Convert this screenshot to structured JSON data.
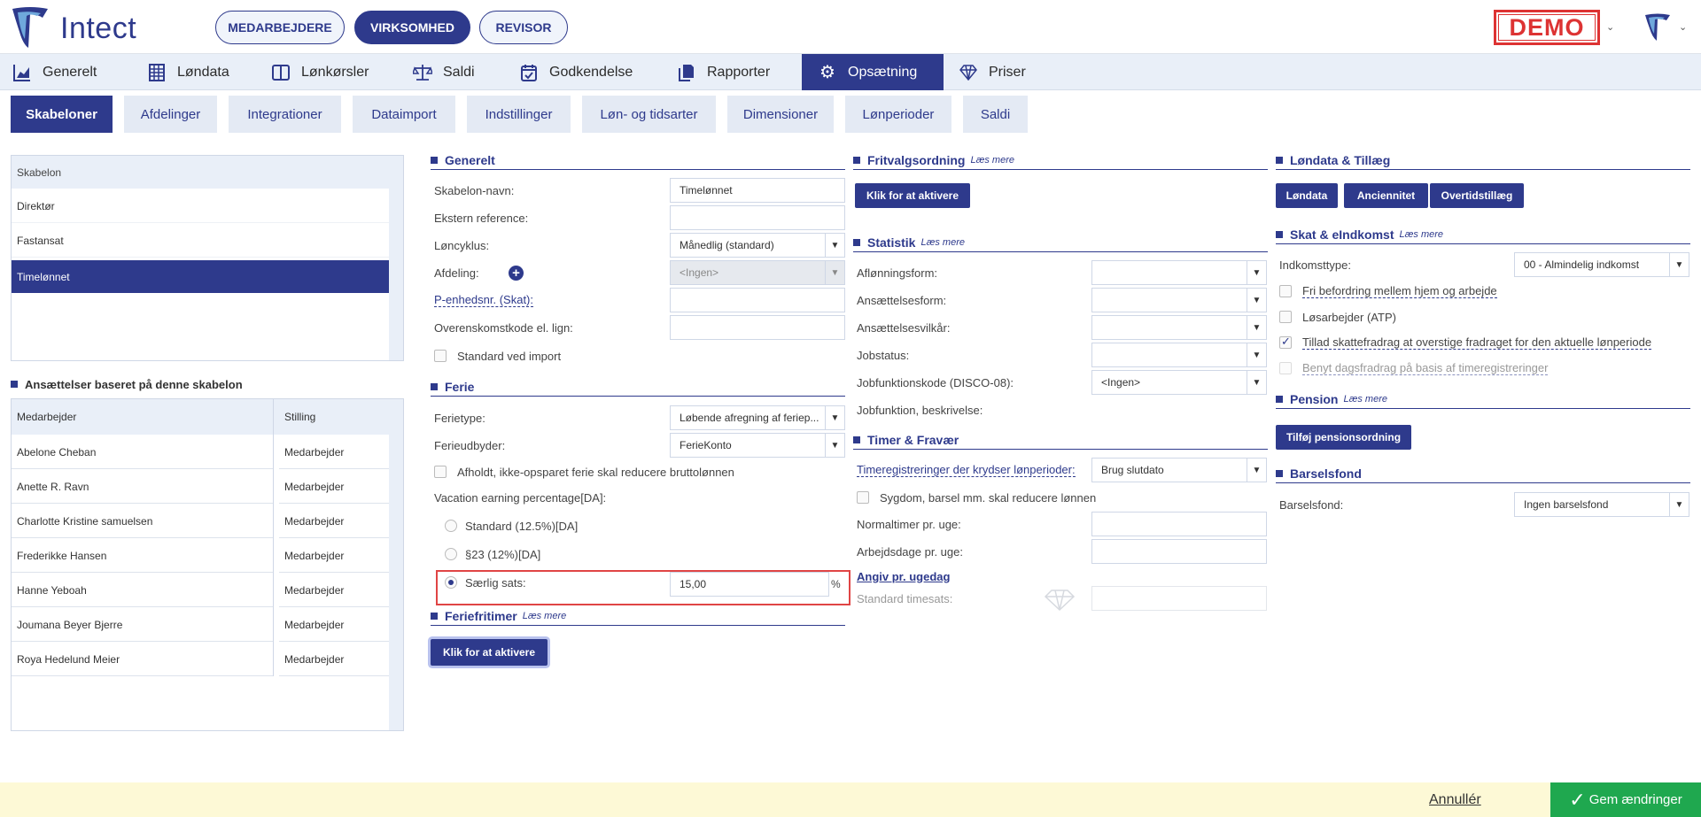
{
  "brand": {
    "name": "Intect",
    "demo_badge": "DEMO",
    "accent": "#2e3a8c",
    "success": "#1fa84f",
    "warning_outline": "#d33"
  },
  "top_pills": [
    {
      "label": "MEDARBEJDERE",
      "active": false
    },
    {
      "label": "VIRKSOMHED",
      "active": true
    },
    {
      "label": "REVISOR",
      "active": false
    }
  ],
  "main_nav": [
    {
      "label": "Generelt",
      "icon": "chart-icon"
    },
    {
      "label": "Løndata",
      "icon": "table-icon"
    },
    {
      "label": "Lønkørsler",
      "icon": "book-icon"
    },
    {
      "label": "Saldi",
      "icon": "scale-icon"
    },
    {
      "label": "Godkendelse",
      "icon": "calendar-check-icon"
    },
    {
      "label": "Rapporter",
      "icon": "documents-icon"
    },
    {
      "label": "Opsætning",
      "icon": "gear-icon",
      "active": true
    },
    {
      "label": "Priser",
      "icon": "diamond-icon"
    }
  ],
  "sub_tabs": [
    {
      "label": "Skabeloner",
      "active": true
    },
    {
      "label": "Afdelinger"
    },
    {
      "label": "Integrationer"
    },
    {
      "label": "Dataimport"
    },
    {
      "label": "Indstillinger"
    },
    {
      "label": "Løn- og tidsarter"
    },
    {
      "label": "Dimensioner"
    },
    {
      "label": "Lønperioder"
    },
    {
      "label": "Saldi"
    }
  ],
  "templates": {
    "header": "Skabelon",
    "items": [
      "Direktør",
      "Fastansat",
      "Timelønnet"
    ],
    "selected": "Timelønnet"
  },
  "employments": {
    "title": "Ansættelser baseret på denne skabelon",
    "columns": [
      "Medarbejder",
      "Stilling"
    ],
    "rows": [
      [
        "Abelone Cheban",
        "Medarbejder"
      ],
      [
        "Anette R. Ravn",
        "Medarbejder"
      ],
      [
        "Charlotte Kristine samuelsen",
        "Medarbejder"
      ],
      [
        "Frederikke Hansen",
        "Medarbejder"
      ],
      [
        "Hanne Yeboah",
        "Medarbejder"
      ],
      [
        "Joumana Beyer Bjerre",
        "Medarbejder"
      ],
      [
        "Roya Hedelund Meier",
        "Medarbejder"
      ]
    ]
  },
  "generelt": {
    "title": "Generelt",
    "name_label": "Skabelon-navn:",
    "name_value": "Timelønnet",
    "extref_label": "Ekstern reference:",
    "cycle_label": "Løncyklus:",
    "cycle_value": "Månedlig (standard)",
    "dept_label": "Afdeling:",
    "dept_value": "<Ingen>",
    "punit_label": "P-enhedsnr. (Skat):",
    "agreement_label": "Overenskomstkode el. lign:",
    "std_import_label": "Standard ved import"
  },
  "ferie": {
    "title": "Ferie",
    "type_label": "Ferietype:",
    "type_value": "Løbende afregning af feriep...",
    "provider_label": "Ferieudbyder:",
    "provider_value": "FerieKonto",
    "reduce_label": "Afholdt, ikke-opsparet ferie skal reducere bruttolønnen",
    "vacation_label": "Vacation earning percentage[DA]:",
    "opt1": "Standard (12.5%)[DA]",
    "opt2": "§23 (12%)[DA]",
    "opt3": "Særlig sats:",
    "special_value": "15,00",
    "percent": "%"
  },
  "feriefritimer": {
    "title": "Feriefritimer",
    "more": "Læs mere",
    "button": "Klik for at aktivere"
  },
  "fritvalg": {
    "title": "Fritvalgsordning",
    "more": "Læs mere",
    "button": "Klik for at aktivere"
  },
  "statistik": {
    "title": "Statistik",
    "more": "Læs mere",
    "fields": [
      "Aflønningsform:",
      "Ansættelsesform:",
      "Ansættelsesvilkår:",
      "Jobstatus:",
      "Jobfunktionskode (DISCO-08):"
    ],
    "disco_value": "<Ingen>",
    "jobdesc_label": "Jobfunktion, beskrivelse:"
  },
  "timer": {
    "title": "Timer & Fravær",
    "crossing_label": "Timeregistreringer der krydser lønperioder:",
    "crossing_value": "Brug slutdato",
    "sick_label": "Sygdom, barsel mm. skal reducere lønnen",
    "normal_label": "Normaltimer pr. uge:",
    "days_label": "Arbejdsdage pr. uge:",
    "weekday_link": "Angiv pr. ugedag",
    "std_rate_label": "Standard timesats:"
  },
  "londata": {
    "title": "Løndata & Tillæg",
    "buttons": [
      "Løndata",
      "Anciennitet",
      "Overtidstillæg"
    ]
  },
  "skat": {
    "title": "Skat & eIndkomst",
    "more": "Læs mere",
    "income_label": "Indkomsttype:",
    "income_value": "00 - Almindelig indkomst",
    "c1": "Fri befordring mellem hjem og arbejde",
    "c2": "Løsarbejder (ATP)",
    "c3": "Tillad skattefradrag at overstige fradraget for den aktuelle lønperiode",
    "c4": "Benyt dagsfradrag på basis af timeregistreringer"
  },
  "pension": {
    "title": "Pension",
    "more": "Læs mere",
    "button": "Tilføj pensionsordning"
  },
  "barsel": {
    "title": "Barselsfond",
    "label": "Barselsfond:",
    "value": "Ingen barselsfond"
  },
  "footer": {
    "cancel": "Annullér",
    "save": "Gem ændringer"
  }
}
